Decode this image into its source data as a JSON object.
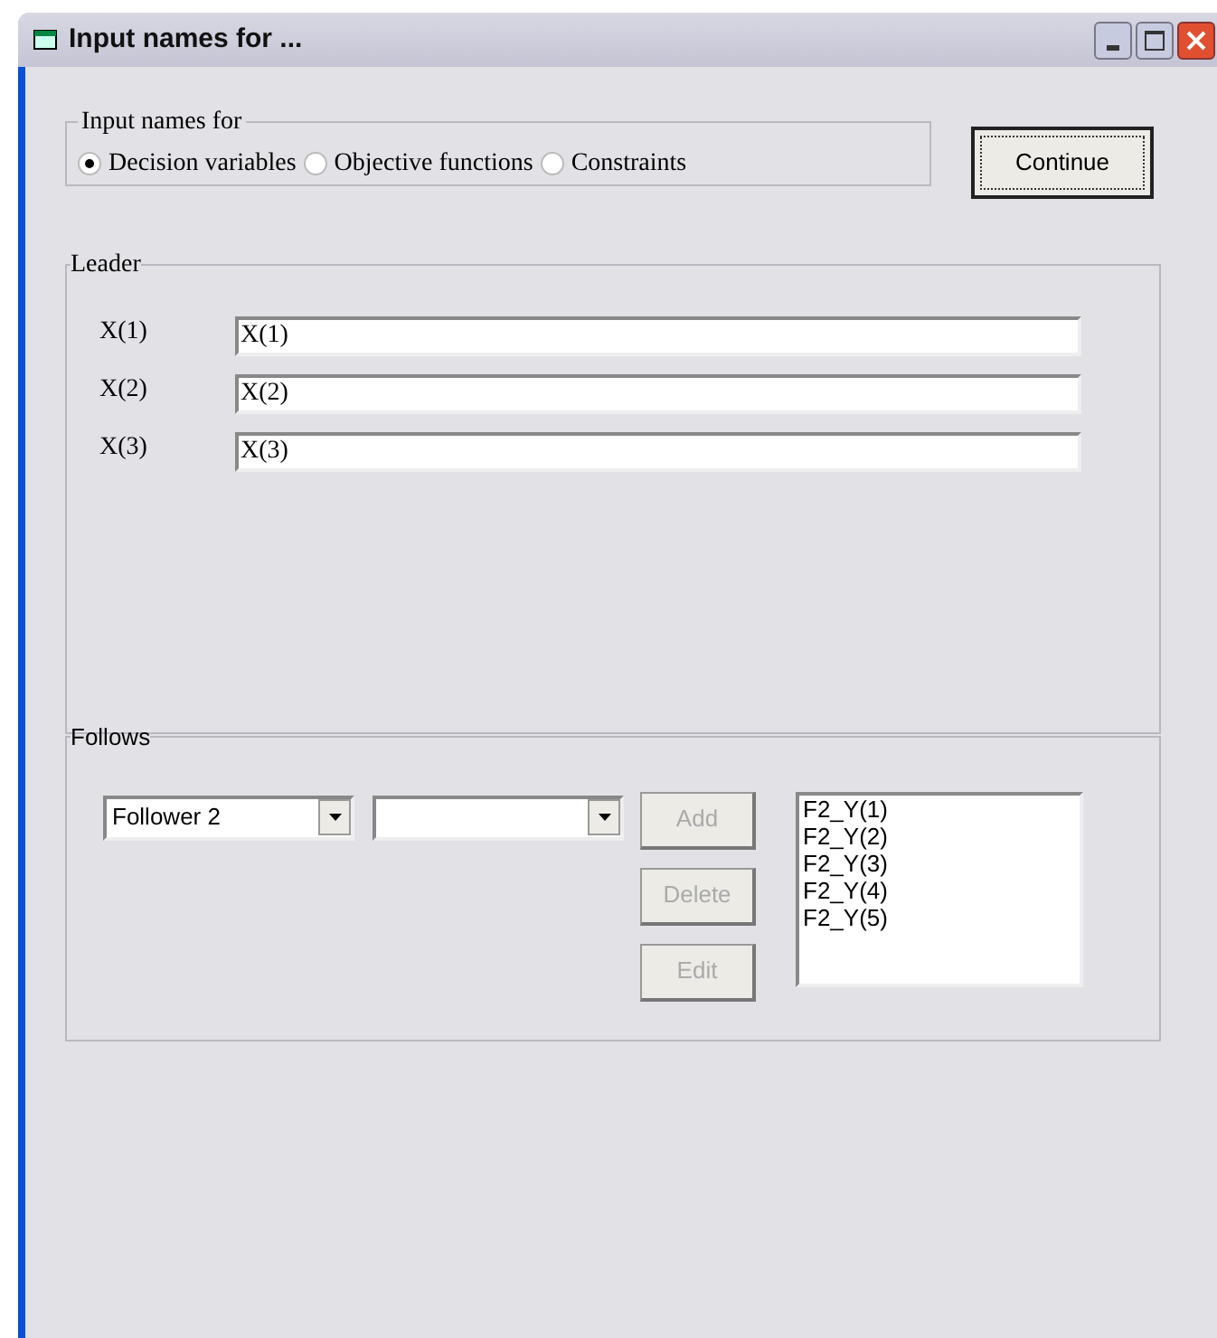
{
  "window": {
    "title": "Input names for ..."
  },
  "input_names_for": {
    "label": "Input names for",
    "options": [
      {
        "label": "Decision variables",
        "selected": true
      },
      {
        "label": "Objective functions",
        "selected": false
      },
      {
        "label": "Constraints",
        "selected": false
      }
    ]
  },
  "continue_button": "Continue",
  "leader": {
    "label": "Leader",
    "rows": [
      {
        "label": "X(1)",
        "value": "X(1)"
      },
      {
        "label": "X(2)",
        "value": "X(2)"
      },
      {
        "label": "X(3)",
        "value": "X(3)"
      }
    ]
  },
  "follows": {
    "label": "Follows",
    "follower_select": "Follower 2",
    "buttons": [
      {
        "label": "Add",
        "disabled": true
      },
      {
        "label": "Delete",
        "disabled": true
      },
      {
        "label": "Edit",
        "disabled": true
      }
    ],
    "list": [
      "F2_Y(1)",
      "F2_Y(2)",
      "F2_Y(3)",
      "F2_Y(4)",
      "F2_Y(5)"
    ]
  }
}
